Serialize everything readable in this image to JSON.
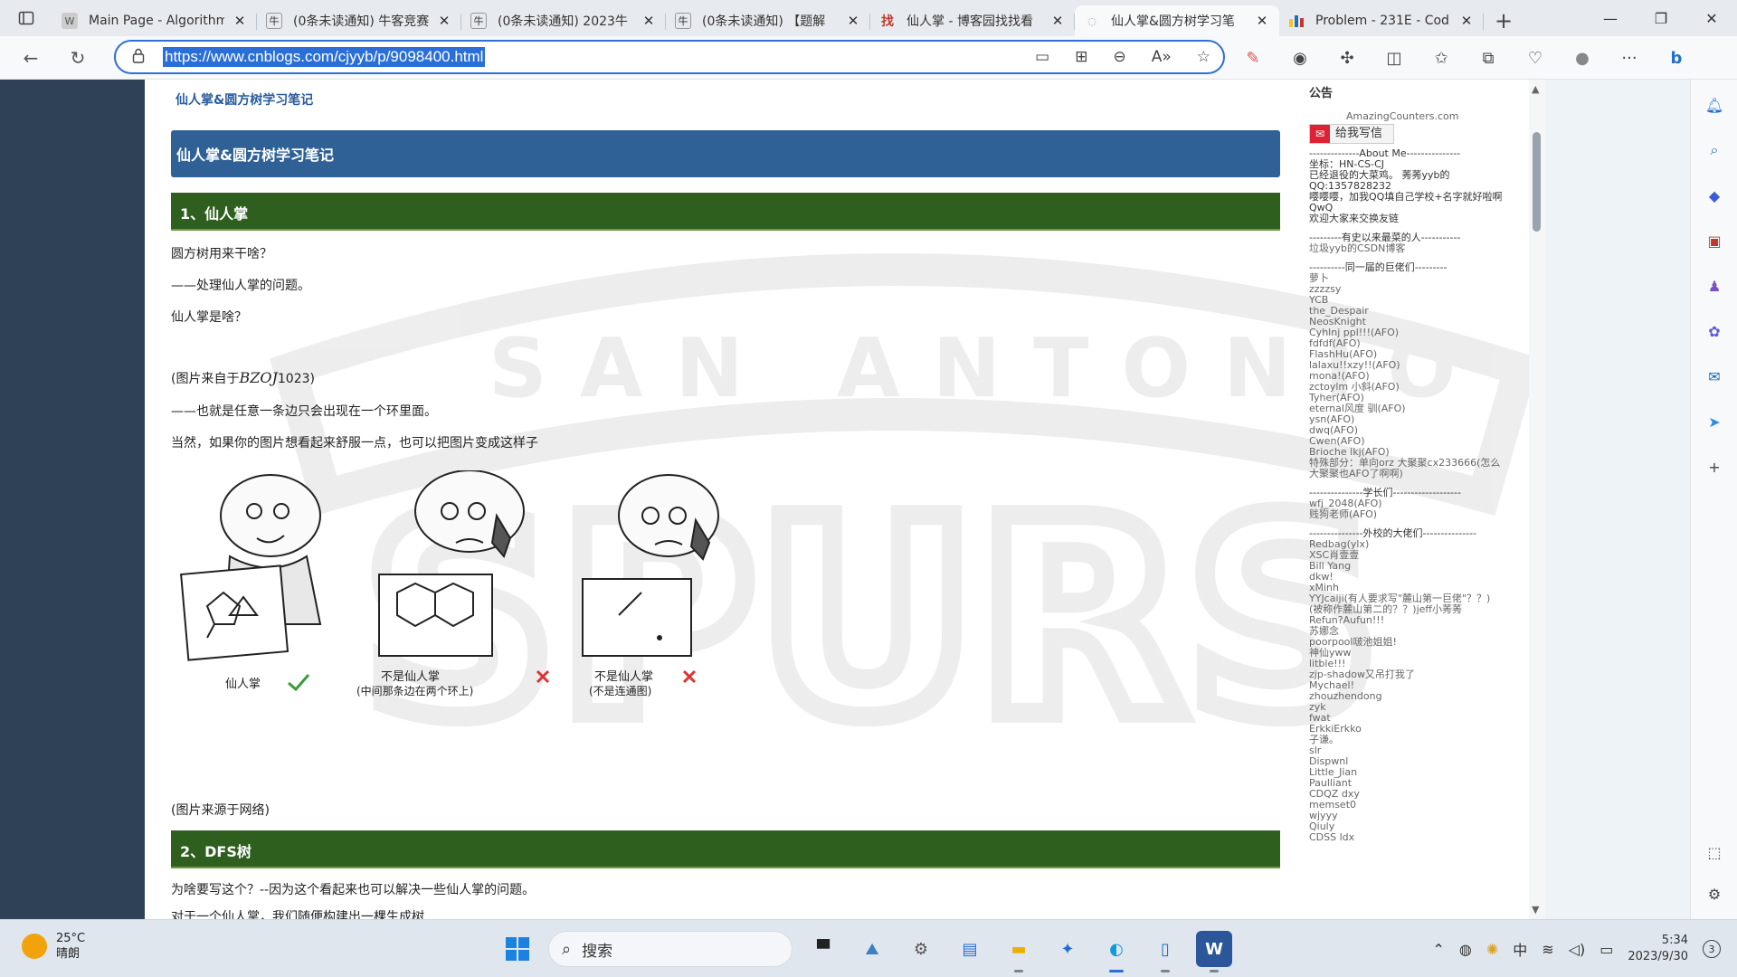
{
  "browser": {
    "tabs": [
      {
        "title": "Main Page - Algorithm",
        "icon": "wiki-icon",
        "active": false
      },
      {
        "title": "(0条未读通知) 牛客竞赛",
        "icon": "nowcoder-icon",
        "active": false
      },
      {
        "title": "(0条未读通知) 2023牛",
        "icon": "nowcoder-icon",
        "active": false
      },
      {
        "title": "(0条未读通知) 【题解",
        "icon": "nowcoder-icon",
        "active": false
      },
      {
        "title": "仙人掌 - 博客园找找看",
        "icon": "cnblogs-search-icon",
        "active": false
      },
      {
        "title": "仙人掌&圆方树学习笔",
        "icon": "cnblogs-icon",
        "active": true
      },
      {
        "title": "Problem - 231E - Cod",
        "icon": "codeforces-icon",
        "active": false
      }
    ],
    "url": "https://www.cnblogs.com/cjyyb/p/9098400.html"
  },
  "post": {
    "breadcrumb": "仙人掌&圆方树学习笔记",
    "title": "仙人掌&圆方树学习笔记",
    "section1": "1、仙人掌",
    "p1": "圆方树用来干啥？",
    "p2": "——处理仙人掌的问题。",
    "p3": "仙人掌是啥？",
    "p4_prefix": "(图片来自于",
    "p4_math": "BZOJ",
    "p4_suffix": "1023)",
    "p5": "——也就是任意一条边只会出现在一个环里面。",
    "p6": "当然，如果你的图片想看起来舒服一点，也可以把图片变成这样子",
    "illus_cap1": "仙人掌",
    "illus_cap2a": "不是仙人掌",
    "illus_cap2b": "(中间那条边在两个环上)",
    "illus_cap3a": "不是仙人掌",
    "illus_cap3b": "(不是连通图)",
    "p7": "(图片来源于网络)",
    "section2": "2、DFS树",
    "p8": "为啥要写这个？--因为这个看起来也可以解决一些仙人掌的问题。",
    "p9": "对于一个仙人掌，我们随便构建出一棵生成树"
  },
  "watermark": {
    "text": "SAN ANTONIO",
    "big": "SPURS"
  },
  "sidebar": {
    "notice": "公告",
    "counter": "AmazingCounters.com",
    "mail": "给我写信",
    "lines": [
      "--------------About Me---------------",
      "坐标：HN-CS-CJ",
      "已经退役的大菜鸡。 莠莠yyb的",
      "QQ:1357828232",
      "嘤嘤嘤，加我QQ填自己学校+名字就好啦啊",
      "QwQ",
      "欢迎大家来交换友链",
      "",
      "---------有史以来最菜的人-----------",
      "垃圾yyb的CSDN博客",
      "",
      "----------同一届的巨佬们---------",
      "萝卜",
      "zzzzsy",
      "YCB",
      "the_Despair",
      "NeosKnight",
      "Cyhlnj ppl!!!(AFO)",
      "fdfdf(AFO)",
      "FlashHu(AFO)",
      "lalaxu!!xzy!!(AFO)",
      "mona!(AFO)",
      "zctoylm 小斜(AFO)",
      "Tyher(AFO)",
      "eternal风度 驯(AFO)",
      "ysn(AFO)",
      "dwq(AFO)",
      "Cwen(AFO)",
      "Brioche lkj(AFO)",
      "特殊部分：单向orz 大聚聚cx233666(怎么",
      "大聚聚也AFO了啊啊)",
      "",
      "---------------学长们-------------------",
      "wfj_2048(AFO)",
      "贱狗老师(AFO)",
      "",
      "---------------外校的大佬们---------------",
      "Redbag(ylx)",
      "XSC肖壹壹",
      "Bill Yang",
      "dkw!",
      "xMinh",
      "YYJcaiji(有人要求写\"麓山第一巨佬\"？？)",
      "(被称作麓山第二的？？)jeff小莠莠",
      "Refun?Aufun!!!",
      "苏娜念",
      "poorpool啵池姐姐!",
      "神仙yww",
      "litble!!!",
      "zjp-shadow又吊打我了",
      "Mychael!",
      "zhouzhendong",
      "zyk",
      "fwat",
      "ErkkiErkko",
      "子谦。",
      "slr",
      "Dispwnl",
      "Little_Jian",
      "Paulliant",
      "CDQZ dxy",
      "memset0",
      "wjyyy",
      "Qiuly",
      "CDSS ldx"
    ]
  },
  "taskbar": {
    "temp": "25°C",
    "weather": "晴朗",
    "search": "搜索",
    "ime": "中",
    "time": "5:34",
    "date": "2023/9/30",
    "notif": "3"
  },
  "colors": {
    "post_title_bg": "#2f6196",
    "section_bg": "#2e5f1f",
    "url_highlight": "#2a6fd8"
  }
}
